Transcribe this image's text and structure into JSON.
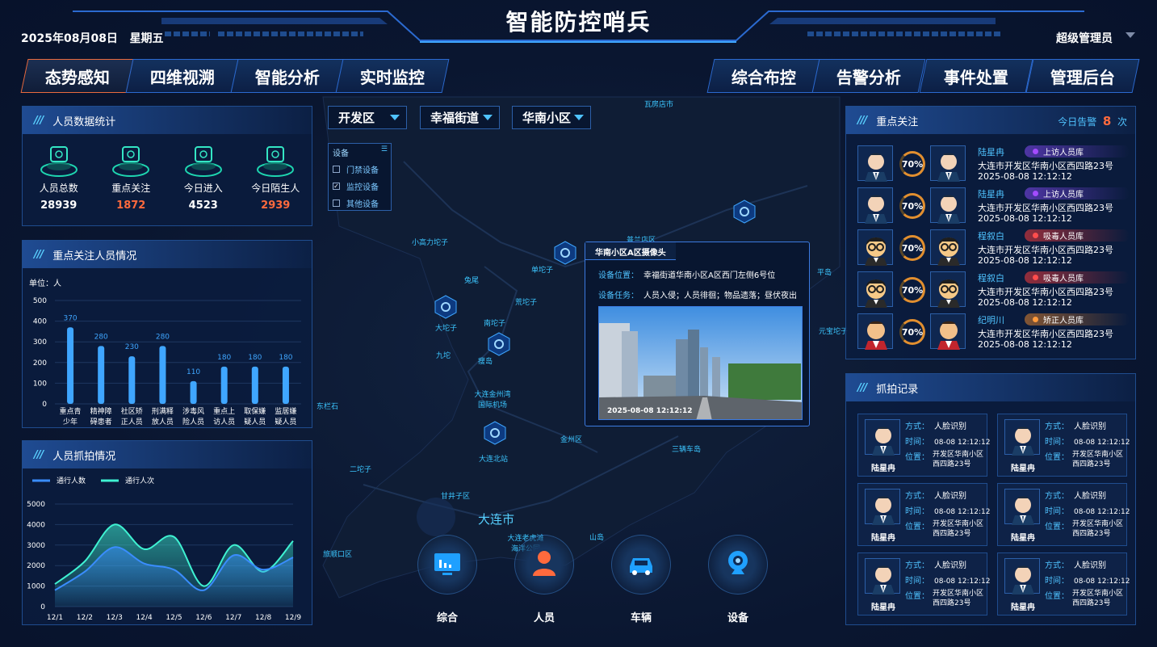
{
  "header": {
    "title": "智能防控哨兵",
    "date": "2025年08月08日",
    "weekday": "星期五",
    "user": "超级管理员"
  },
  "nav_left": [
    "态势感知",
    "四维视溯",
    "智能分析",
    "实时监控"
  ],
  "nav_right": [
    "综合布控",
    "告警分析",
    "事件处置",
    "管理后台"
  ],
  "active_tab": "态势感知",
  "people_stats": {
    "title": "人员数据统计",
    "items": [
      {
        "label": "人员总数",
        "value": "28939",
        "color": "#ffffff",
        "icon": "id-card-icon"
      },
      {
        "label": "重点关注",
        "value": "1872",
        "color": "#ff6a3d",
        "icon": "shield-check-icon"
      },
      {
        "label": "今日进入",
        "value": "4523",
        "color": "#ffffff",
        "icon": "no-entry-icon"
      },
      {
        "label": "今日陌生人",
        "value": "2939",
        "color": "#ff6a3d",
        "icon": "search-person-icon"
      }
    ]
  },
  "focus_chart_panel": {
    "title": "重点关注人员情况",
    "unit": "单位：人"
  },
  "capture_chart_panel": {
    "title": "人员抓拍情况"
  },
  "chart_data": [
    {
      "type": "bar",
      "categories": [
        "重点青少年",
        "精神障碍患者",
        "社区矫正人员",
        "刑满释放人员",
        "涉毒风险人员",
        "重点上访人员",
        "取保嫌疑人员",
        "监居嫌疑人员"
      ],
      "category_lines": [
        [
          "重点青",
          "少年"
        ],
        [
          "精神障",
          "碍患者"
        ],
        [
          "社区矫",
          "正人员"
        ],
        [
          "刑满释",
          "放人员"
        ],
        [
          "涉毒风",
          "险人员"
        ],
        [
          "重点上",
          "访人员"
        ],
        [
          "取保嫌",
          "疑人员"
        ],
        [
          "监居嫌",
          "疑人员"
        ]
      ],
      "values": [
        370,
        280,
        230,
        280,
        110,
        180,
        180,
        180
      ],
      "value_labels": [
        "370",
        "280",
        "230",
        "280",
        "110",
        "180",
        "180",
        "180"
      ],
      "ylim": [
        0,
        500
      ],
      "yticks": [
        "0",
        "100",
        "200",
        "300",
        "400",
        "500"
      ],
      "ylabel": "单位：人",
      "bar_color": "#3fa6ff",
      "grid": true
    },
    {
      "type": "area",
      "categories": [
        "12/1",
        "12/2",
        "12/3",
        "12/4",
        "12/5",
        "12/6",
        "12/7",
        "12/8",
        "12/9"
      ],
      "series": [
        {
          "name": "通行人数",
          "values": [
            800,
            1700,
            2900,
            2100,
            1800,
            800,
            2500,
            1800,
            2400
          ],
          "color": "#3a8dff"
        },
        {
          "name": "通行人次",
          "values": [
            1100,
            2200,
            4000,
            2800,
            3400,
            1000,
            3000,
            1700,
            3200
          ],
          "color": "#3ff2d2"
        }
      ],
      "ylim": [
        0,
        5000
      ],
      "yticks": [
        "0",
        "1000",
        "2000",
        "3000",
        "4000",
        "5000"
      ],
      "legend": "top-left",
      "grid": true
    }
  ],
  "filters": [
    "开发区",
    "幸福街道",
    "华南小区"
  ],
  "device_filter": {
    "title": "设备",
    "items": [
      {
        "label": "门禁设备",
        "checked": false
      },
      {
        "label": "监控设备",
        "checked": true
      },
      {
        "label": "其他设备",
        "checked": false
      }
    ]
  },
  "map_labels": [
    "瓦房店市",
    "普兰店区",
    "小高力坨子",
    "兔尾",
    "单坨子",
    "荒坨子",
    "平岛",
    "大坨子",
    "南坨子",
    "元宝坨子",
    "九坨",
    "瘦岛",
    "大连金州湾国际机场",
    "东栏石",
    "金州区",
    "三辆车岛",
    "二坨子",
    "大连北站",
    "甘井子区",
    "大连市",
    "大连老虎滩海洋公园",
    "山岛",
    "旅顺口区"
  ],
  "popup": {
    "title": "华南小区A区摄像头",
    "location_label": "设备位置：",
    "location": "幸福街道华南小区A区西门左侧6号位",
    "task_label": "设备任务：",
    "task": "人员入侵；人员徘徊；物品遗落；昼伏夜出",
    "timestamp": "2025-08-08  12:12:12"
  },
  "bottom_buttons": [
    {
      "label": "综合",
      "icon": "monitor-chart-icon"
    },
    {
      "label": "人员",
      "icon": "person-icon"
    },
    {
      "label": "车辆",
      "icon": "car-icon"
    },
    {
      "label": "设备",
      "icon": "camera-icon"
    }
  ],
  "focus_panel": {
    "title": "重点关注",
    "alert_label": "今日告警",
    "alert_count": "8",
    "alert_unit": "次",
    "items": [
      {
        "name": "陆星冉",
        "tag": "上访人员库",
        "tag_color": "#a44bff",
        "tag_bg": "rgba(95,60,190,0.8)",
        "address": "大连市开发区华南小区西四路23号",
        "time": "2025-08-08  12:12:12",
        "percent": "70%",
        "avatar": "male-suit"
      },
      {
        "name": "陆星冉",
        "tag": "上访人员库",
        "tag_color": "#a44bff",
        "tag_bg": "rgba(95,60,190,0.8)",
        "address": "大连市开发区华南小区西四路23号",
        "time": "2025-08-08  12:12:12",
        "percent": "70%",
        "avatar": "male-suit"
      },
      {
        "name": "程叙白",
        "tag": "吸毒人员库",
        "tag_color": "#ff4d4d",
        "tag_bg": "rgba(180,50,60,0.8)",
        "address": "大连市开发区华南小区西四路23号",
        "time": "2025-08-08  12:12:12",
        "percent": "70%",
        "avatar": "glasses"
      },
      {
        "name": "程叙白",
        "tag": "吸毒人员库",
        "tag_color": "#ff4d4d",
        "tag_bg": "rgba(180,50,60,0.8)",
        "address": "大连市开发区华南小区西四路23号",
        "time": "2025-08-08  12:12:12",
        "percent": "70%",
        "avatar": "glasses"
      },
      {
        "name": "纪明川",
        "tag": "矫正人员库",
        "tag_color": "#ff9a3d",
        "tag_bg": "rgba(160,100,50,0.8)",
        "address": "大连市开发区华南小区西四路23号",
        "time": "2025-08-08  12:12:12",
        "percent": "70%",
        "avatar": "red-vest"
      }
    ]
  },
  "capture_panel": {
    "title": "抓拍记录",
    "method_label": "方式：",
    "time_label": "时间：",
    "location_label": "位置：",
    "records": [
      {
        "name": "陆星冉",
        "method": "人脸识别",
        "time": "08-08 12:12:12",
        "location": "开发区华南小区西四路23号"
      },
      {
        "name": "陆星冉",
        "method": "人脸识别",
        "time": "08-08 12:12:12",
        "location": "开发区华南小区西四路23号"
      },
      {
        "name": "陆星冉",
        "method": "人脸识别",
        "time": "08-08 12:12:12",
        "location": "开发区华南小区西四路23号"
      },
      {
        "name": "陆星冉",
        "method": "人脸识别",
        "time": "08-08 12:12:12",
        "location": "开发区华南小区西四路23号"
      },
      {
        "name": "陆星冉",
        "method": "人脸识别",
        "time": "08-08 12:12:12",
        "location": "开发区华南小区西四路23号"
      },
      {
        "name": "陆星冉",
        "method": "人脸识别",
        "time": "08-08 12:12:12",
        "location": "开发区华南小区西四路23号"
      }
    ]
  }
}
